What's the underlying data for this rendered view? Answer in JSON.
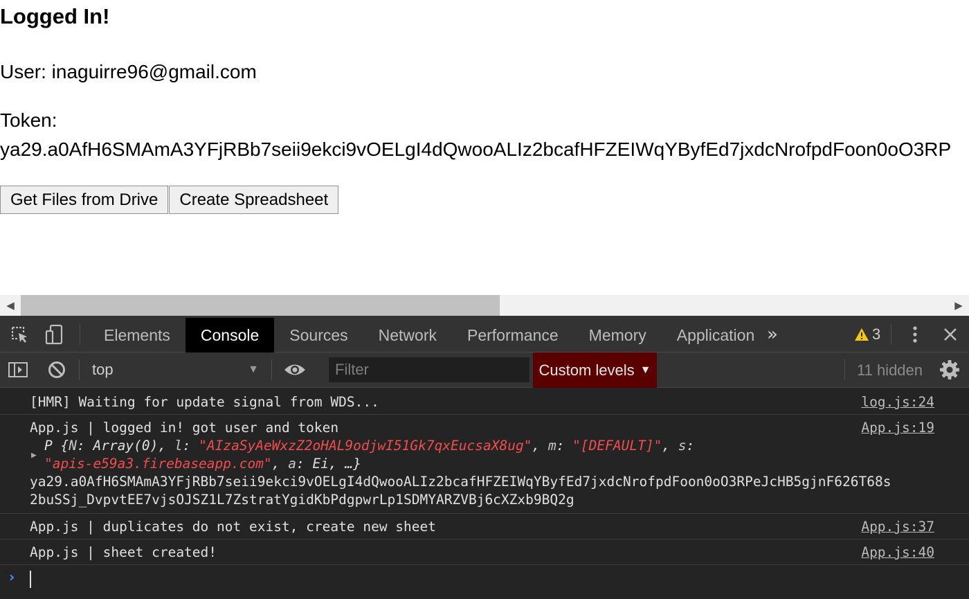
{
  "page": {
    "title": "Logged In!",
    "user_line": "User: inaguirre96@gmail.com",
    "token_label": "Token:",
    "token_value": "ya29.a0AfH6SMAmA3YFjRBb7seii9ekci9vOELgI4dQwooALIz2bcafHFZEIWqYByfEd7jxdcNrofpdFoon0oO3RP",
    "buttons": {
      "get_files": "Get Files from Drive",
      "create_sheet": "Create Spreadsheet"
    }
  },
  "scrollbar": {
    "left_arrow": "◀",
    "right_arrow": "▶"
  },
  "devtools": {
    "tabs": [
      "Elements",
      "Console",
      "Sources",
      "Network",
      "Performance",
      "Memory",
      "Application"
    ],
    "active_tab": "Console",
    "more_tabs": "»",
    "warning_count": "3",
    "toolbar": {
      "context": "top",
      "filter_placeholder": "Filter",
      "levels": "Custom levels",
      "hidden": "11 hidden"
    },
    "messages": [
      {
        "text": "[HMR] Waiting for update signal from WDS...",
        "source": "log.js:24"
      },
      {
        "text": "App.js | logged in! got user and token",
        "source": "App.js:19",
        "object": {
          "prefix": "P {",
          "n_key": "N",
          "n_val": "Array(0)",
          "l_key": "l",
          "l_val": "\"AIzaSyAeWxzZ2oHAL9odjwI51Gk7qxEucsaX8ug\"",
          "m_key": "m",
          "m_val": "\"[DEFAULT]\"",
          "s_key": "s",
          "s_val": "\"apis-e59a3.firebaseapp.com\"",
          "a_key": "a",
          "a_val": "Ei",
          "suffix": "…}"
        },
        "token_line1": "ya29.a0AfH6SMAmA3YFjRBb7seii9ekci9vOELgI4dQwooALIz2bcafHFZEIWqYByfEd7jxdcNrofpdFoon0oO3RPeJcHB5gjnF626T68s",
        "token_line2": "2buSSj_DvpvtEE7vjsOJSZ1L7ZstratYgidKbPdgpwrLp1SDMYARZVBj6cXZxb9BQ2g"
      },
      {
        "text": "App.js | duplicates do not exist, create new sheet",
        "source": "App.js:37"
      },
      {
        "text": "App.js | sheet created!",
        "source": "App.js:40"
      }
    ],
    "prompt": "›"
  },
  "colors": {
    "devtools_bg": "#242424",
    "toolbar_bg": "#333333",
    "active_tab_bg": "#000000",
    "levels_bg": "#5a0000",
    "string_red": "#f24d4d",
    "prompt_blue": "#4d90fe",
    "warning_yellow": "#f5c518"
  }
}
